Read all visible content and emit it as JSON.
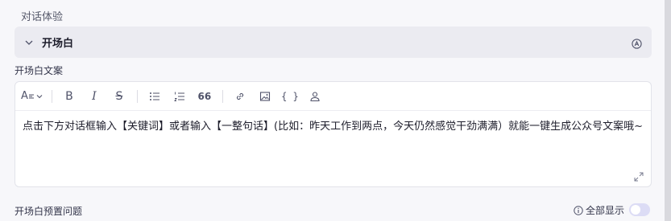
{
  "section_title": "对话体验",
  "collapse": {
    "title": "开场白"
  },
  "field_label": "开场白文案",
  "toolbar": {
    "heading_label": "A",
    "bold_label": "B",
    "italic_label": "I",
    "strike_label": "S",
    "quote_label": "66",
    "code_label": "{ }"
  },
  "editor": {
    "content": "点击下方对话框输入【关键词】或者输入【一整句话】(比如：昨天工作到两点，今天仍然感觉干劲满满）就能一键生成公众号文案哦~"
  },
  "preset": {
    "label": "开场白预置问题",
    "show_all_label": "全部显示",
    "show_all_on": false
  },
  "colors": {
    "accent": "#5b5fd9",
    "toggle_off": "#dcdcf5",
    "header_bg": "#ebebf1"
  }
}
